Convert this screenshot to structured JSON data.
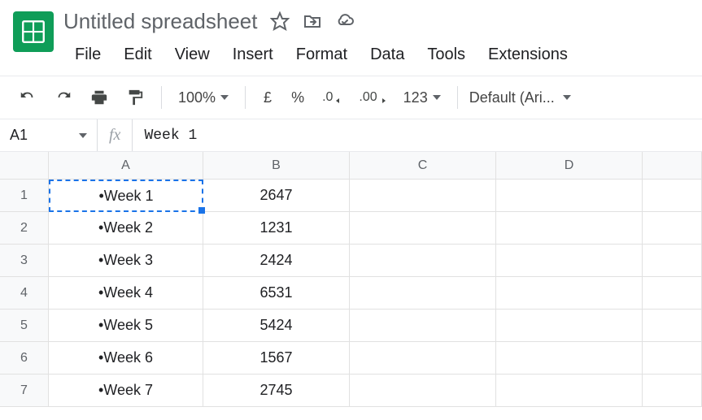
{
  "title": "Untitled spreadsheet",
  "menubar": [
    "File",
    "Edit",
    "View",
    "Insert",
    "Format",
    "Data",
    "Tools",
    "Extensions"
  ],
  "toolbar": {
    "zoom": "100%",
    "currency": "£",
    "percent": "%",
    "decimal_dec": ".0",
    "decimal_inc": ".00",
    "format_number": "123",
    "font": "Default (Ari..."
  },
  "name_box": "A1",
  "fx_label": "fx",
  "formula_value": "Week 1",
  "columns": [
    "A",
    "B",
    "C",
    "D",
    ""
  ],
  "rows": [
    {
      "n": "1",
      "a": "•Week 1",
      "b": "2647"
    },
    {
      "n": "2",
      "a": "•Week 2",
      "b": "1231"
    },
    {
      "n": "3",
      "a": "•Week 3",
      "b": "2424"
    },
    {
      "n": "4",
      "a": "•Week 4",
      "b": "6531"
    },
    {
      "n": "5",
      "a": "•Week 5",
      "b": "5424"
    },
    {
      "n": "6",
      "a": "•Week 6",
      "b": "1567"
    },
    {
      "n": "7",
      "a": "•Week 7",
      "b": "2745"
    }
  ],
  "selected_cell": "A1"
}
